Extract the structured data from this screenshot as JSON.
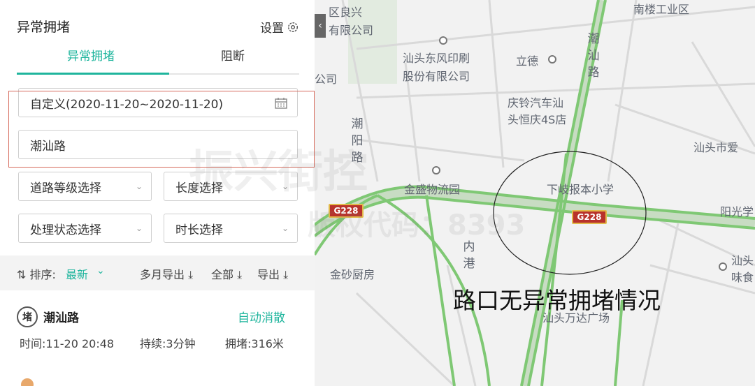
{
  "panel": {
    "title": "异常拥堵",
    "settings_label": "设置",
    "tabs": [
      {
        "label": "异常拥堵"
      },
      {
        "label": "阻断"
      }
    ],
    "date_range": "自定义(2020-11-20~2020-11-20)",
    "road_input": "潮汕路",
    "selects": [
      {
        "label": "道路等级选择"
      },
      {
        "label": "长度选择"
      },
      {
        "label": "处理状态选择"
      },
      {
        "label": "时长选择"
      }
    ],
    "sort": {
      "label": "排序:",
      "value": "最新"
    },
    "exports": [
      {
        "label": "多月导出"
      },
      {
        "label": "全部"
      },
      {
        "label": "导出"
      }
    ],
    "card": {
      "badge": "堵",
      "road": "潮汕路",
      "status": "自动消散",
      "time": "时间:11-20 20:48",
      "duration": "持续:3分钟",
      "jam": "拥堵:316米"
    }
  },
  "map": {
    "labels": [
      {
        "text": "区良兴"
      },
      {
        "text": "有限公司"
      },
      {
        "text": "汕头东风印刷"
      },
      {
        "text": "股份有限公司"
      },
      {
        "text": "立德"
      },
      {
        "text": "庆铃汽车汕"
      },
      {
        "text": "头恒庆4S店"
      },
      {
        "text": "公司"
      },
      {
        "text": "汕头市爱"
      },
      {
        "text": "金盛物流园"
      },
      {
        "text": "下岐报本小学"
      },
      {
        "text": "阳光学"
      },
      {
        "text": "金砂厨房"
      },
      {
        "text": "汕头"
      },
      {
        "text": "味食"
      },
      {
        "text": "汕头万达广场"
      },
      {
        "text": "南楼工业区"
      }
    ],
    "vertical_labels": [
      {
        "text": "潮汕路"
      },
      {
        "text": "潮阳路"
      },
      {
        "text": "内港"
      }
    ],
    "shields": [
      {
        "text": "G228"
      },
      {
        "text": "G228"
      }
    ],
    "annotation": "路口无异常拥堵情况",
    "watermark_1": "振兴街控",
    "watermark_2": "版权代码：8393"
  },
  "colors": {
    "accent": "#1fb59d",
    "road_green": "#7fc874",
    "highlight_box": "#d66a5c",
    "shield_red": "#b8322b"
  }
}
